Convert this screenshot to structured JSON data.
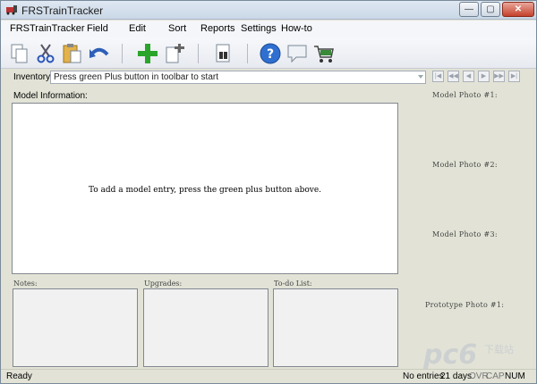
{
  "window": {
    "title": "FRSTrainTracker"
  },
  "menu": [
    "FRSTrainTracker",
    "Field",
    "Edit",
    "Sort",
    "Reports",
    "Settings",
    "How-to"
  ],
  "toolbar": {
    "icons": [
      "copy-icon",
      "cut-icon",
      "paste-icon",
      "undo-icon",
      "add-icon",
      "duplicate-icon",
      "find-icon",
      "help-icon",
      "comment-icon",
      "cart-icon"
    ]
  },
  "inventory": {
    "label": "Inventory:",
    "value": "Press green Plus button in toolbar to start"
  },
  "model_info": {
    "label": "Model Information:",
    "message": "To add a model entry, press the green plus button above."
  },
  "photos": [
    "Model Photo #1:",
    "Model Photo #2:",
    "Model Photo #3:",
    "Prototype Photo #1:"
  ],
  "panels": [
    "Notes:",
    "Upgrades:",
    "To-do List:"
  ],
  "status": {
    "ready": "Ready",
    "entries": "No entries",
    "days": "21 days",
    "ovr": "OVR",
    "cap": "CAP",
    "num": "NUM"
  },
  "watermark": {
    "text": "pc6",
    "sub": "下载站"
  },
  "colors": {
    "accent_green": "#2aa52a",
    "background": "#e2e3d6"
  }
}
